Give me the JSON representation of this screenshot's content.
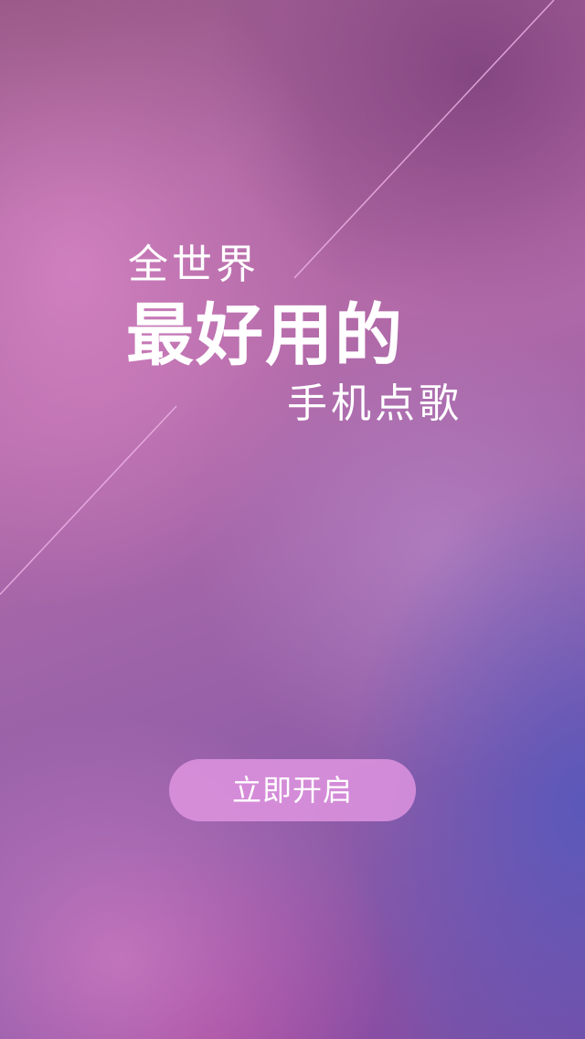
{
  "headline": {
    "line1": "全世界",
    "line2": "最好用的",
    "line3": "手机点歌"
  },
  "start_button": {
    "label": "立即开启"
  },
  "colors": {
    "button_bg": "#e296e2",
    "text": "#ffffff",
    "deco_line": "#f0b6e8"
  }
}
